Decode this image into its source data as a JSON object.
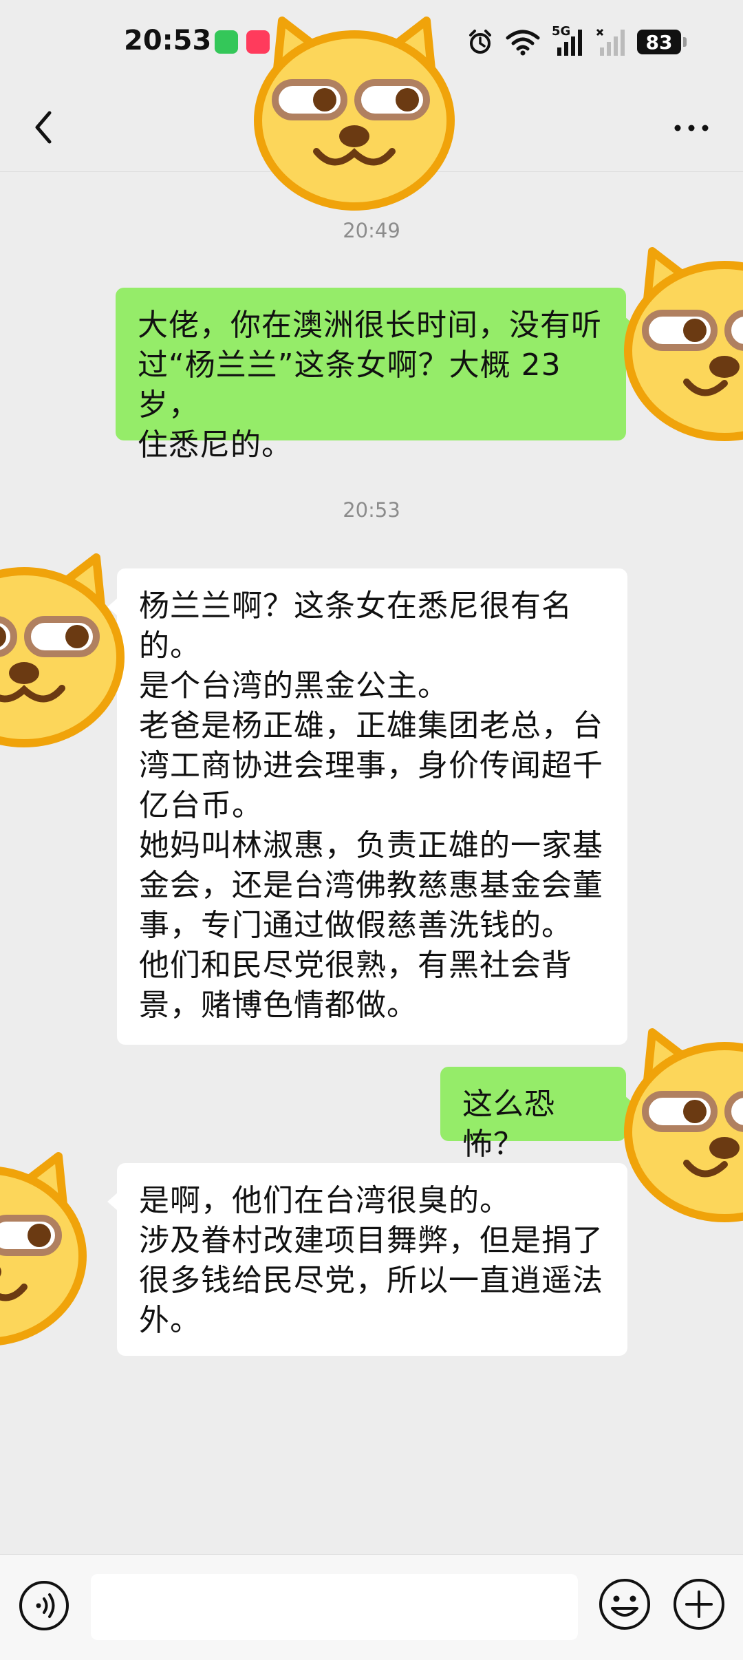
{
  "status_bar": {
    "time": "20:53",
    "battery": "83",
    "network_label": "5G",
    "icons": [
      "message-app-icon",
      "shop-app-icon",
      "alarm-icon",
      "wifi-icon",
      "signal-icon",
      "signal-weak-icon",
      "battery-icon"
    ]
  },
  "header": {
    "back_icon": "chevron-left-icon",
    "more_icon": "more-dots-icon"
  },
  "messages": [
    {
      "type": "time",
      "text": "20:49"
    },
    {
      "type": "outgoing",
      "text": "大佬，你在澳洲很长时间，没有听\n过“杨兰兰”这条女啊？大概 23 岁，\n住悉尼的。"
    },
    {
      "type": "time",
      "text": "20:53"
    },
    {
      "type": "incoming",
      "text": "杨兰兰啊？这条女在悉尼很有名\n的。\n是个台湾的黑金公主。\n老爸是杨正雄，正雄集团老总，台\n湾工商协进会理事，身价传闻超千\n亿台币。\n她妈叫林淑惠，负责正雄的一家基\n金会，还是台湾佛教慈惠基金会董\n事，专门通过做假慈善洗钱的。\n他们和民尽党很熟，有黑社会背\n景，赌博色情都做。"
    },
    {
      "type": "outgoing",
      "text": "这么恐怖？"
    },
    {
      "type": "incoming",
      "text": "是啊，他们在台湾很臭的。\n涉及眷村改建项目舞弊，但是捐了\n很多钱给民尽党，所以一直逍遥法\n外。"
    }
  ],
  "stickers": {
    "name": "dog-face-sticker",
    "color": "#fcd65a",
    "outline": "#f0a30a"
  },
  "input_bar": {
    "voice_icon": "voice-icon",
    "input_value": "",
    "emoji_icon": "emoji-icon",
    "plus_icon": "plus-icon"
  },
  "colors": {
    "background": "#ededed",
    "outgoing_bubble": "#95ec69",
    "incoming_bubble": "#ffffff",
    "time_text": "#8c8c8c"
  }
}
